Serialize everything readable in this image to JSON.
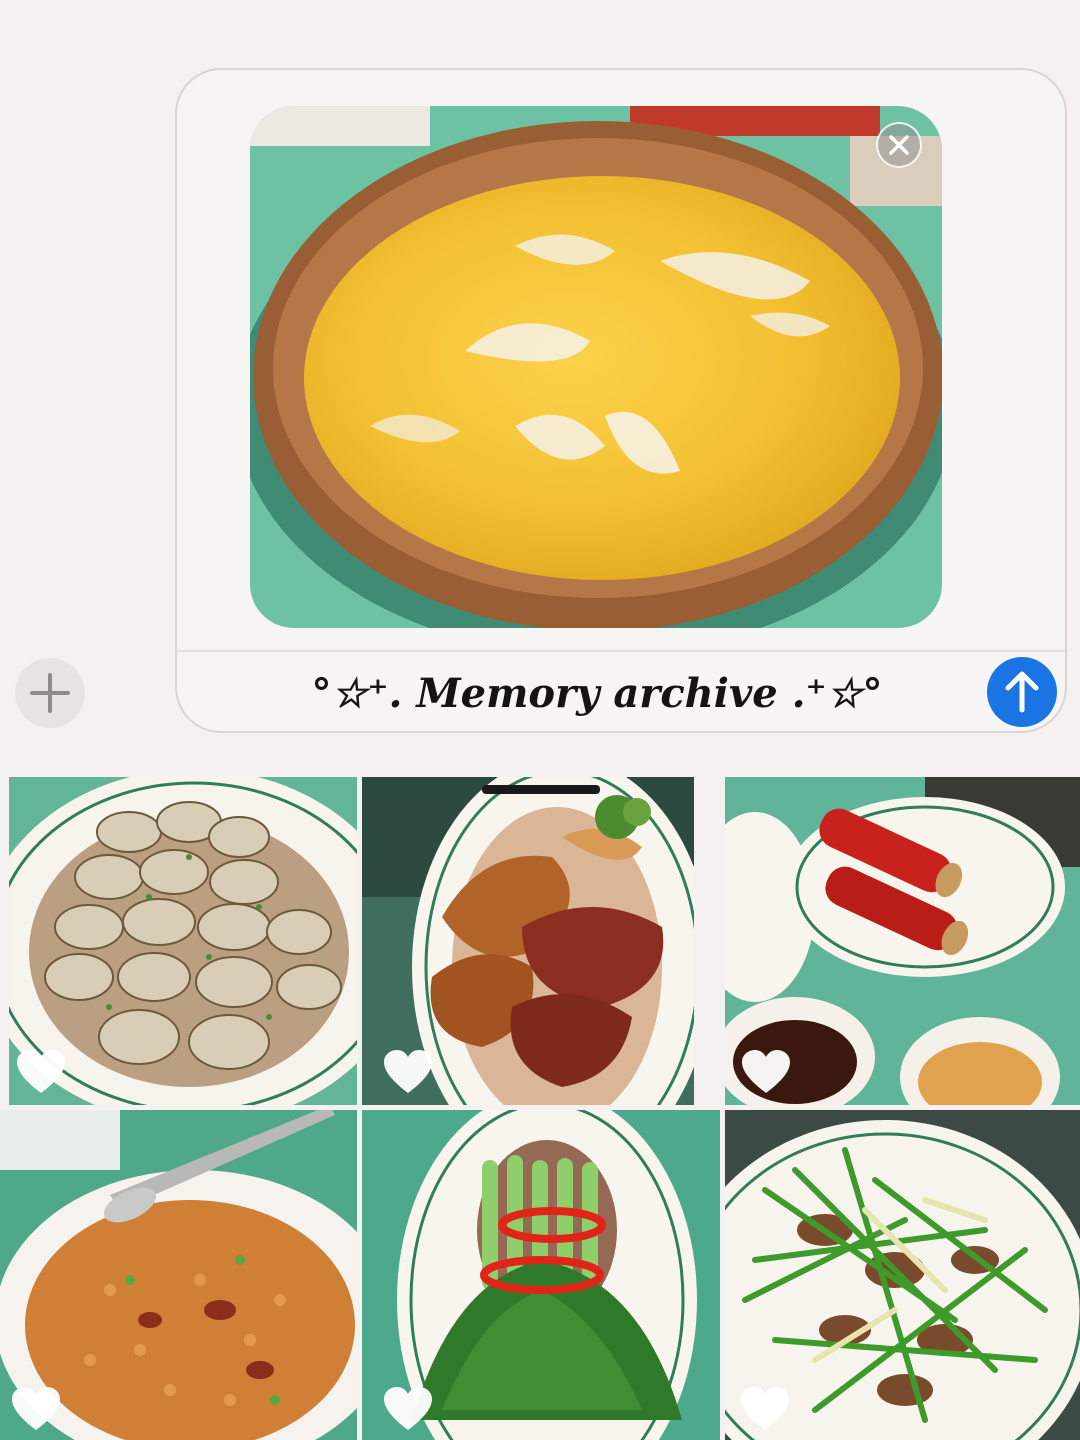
{
  "composer": {
    "message_text": "°☆⁺. Memory archive .⁺☆°",
    "add_icon": "plus-icon",
    "send_icon": "arrow-up-icon",
    "remove_icon": "close-icon"
  },
  "attachment": {
    "subject": "soup-in-clay-pot"
  },
  "photos": [
    {
      "subject": "steamed-clams",
      "favorite": "heart-icon"
    },
    {
      "subject": "roast-goose-and-char-siu",
      "favorite": "heart-icon"
    },
    {
      "subject": "chinese-sausage",
      "favorite": "heart-icon"
    },
    {
      "subject": "clay-pot-rice",
      "favorite": "heart-icon"
    },
    {
      "subject": "chinese-broccoli",
      "favorite": "heart-icon"
    },
    {
      "subject": "stir-fried-beef-with-chives",
      "favorite": "heart-icon"
    }
  ],
  "colors": {
    "background": "#f5f1f1",
    "send_button": "#1b74e4",
    "table_green": "#5fb49a"
  }
}
